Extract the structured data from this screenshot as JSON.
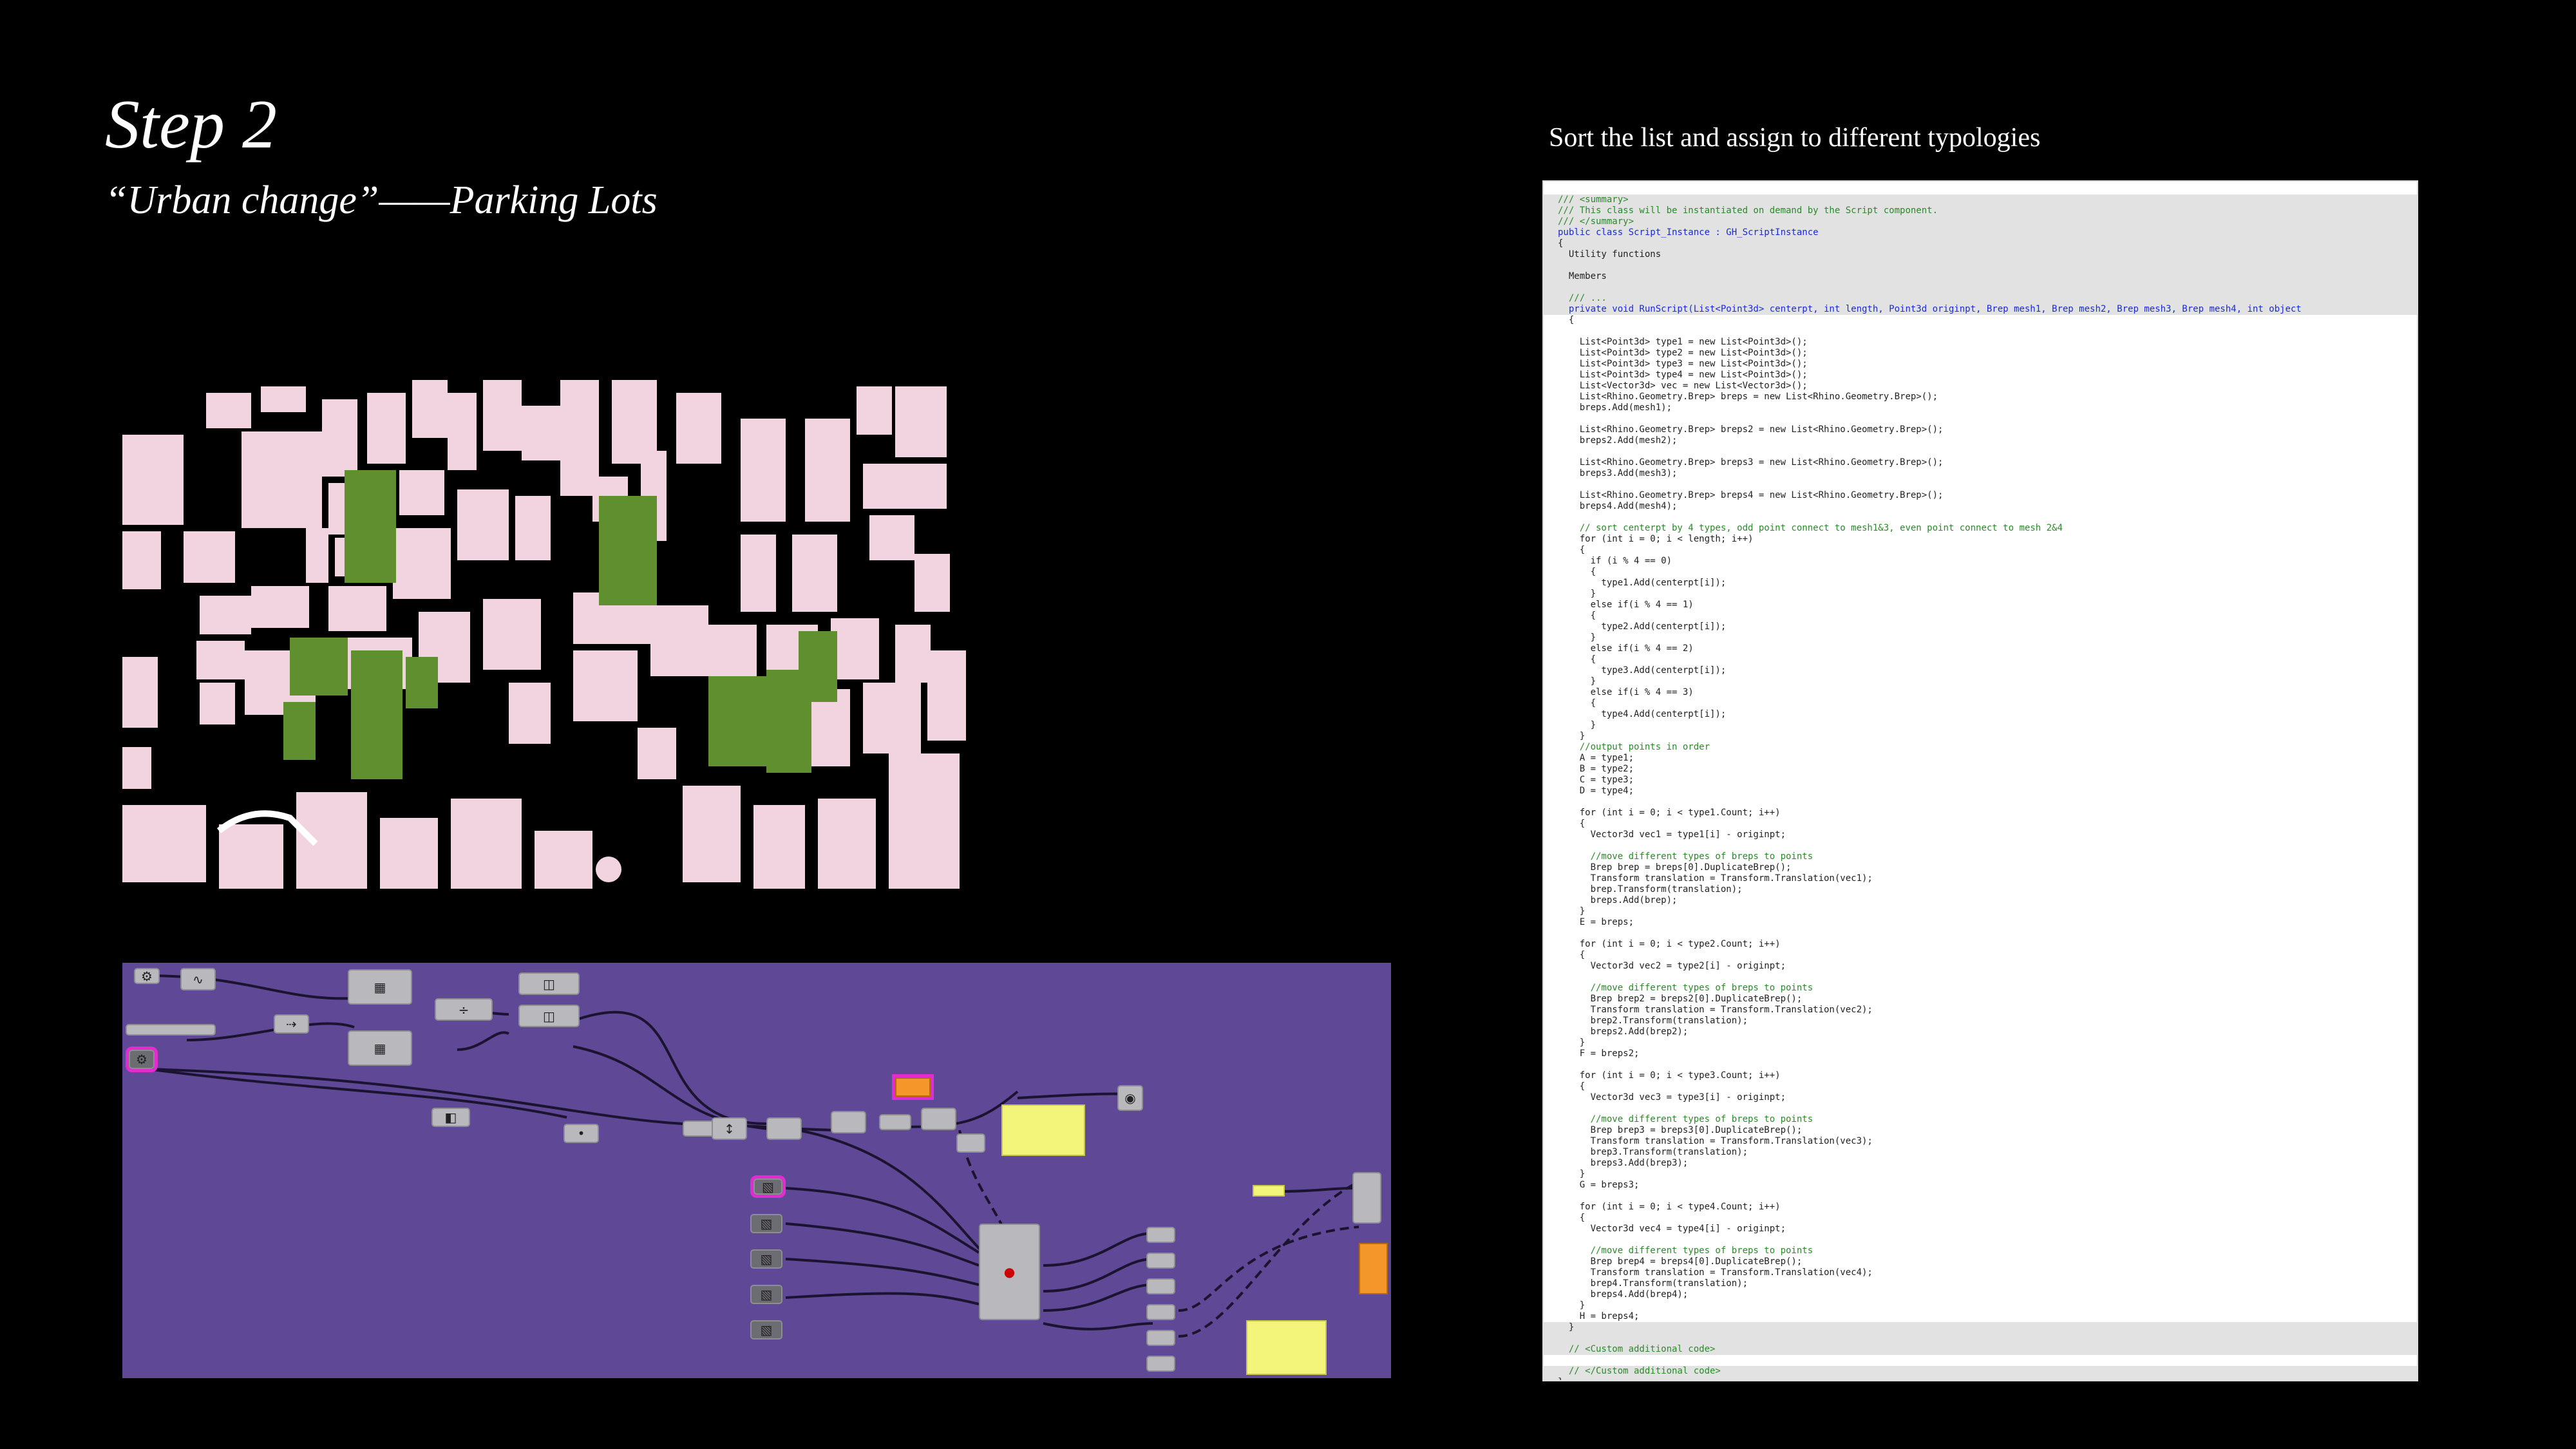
{
  "slide": {
    "title": "Step 2",
    "subtitle": "“Urban change”——Parking Lots",
    "code_caption": "Sort the list and assign to different typologies"
  },
  "colors": {
    "background": "#000000",
    "map_building": "#f2d3e0",
    "map_parking": "#5f8f2f",
    "canvas": "#5f4896",
    "panel": "#f3f57a",
    "component": "#b9b9bd",
    "highlight": "#e12ccf",
    "output_param": "#f5962a",
    "code_comment": "#2a8a2a",
    "code_keyword": "#1a2ad8"
  },
  "code_lines": [
    {
      "text": "/// <summary>",
      "cls": "cm",
      "gray": true
    },
    {
      "text": "/// This class will be instantiated on demand by the Script component.",
      "cls": "cm",
      "gray": true
    },
    {
      "text": "/// </summary>",
      "cls": "cm",
      "gray": true
    },
    {
      "text": "public class Script_Instance : GH_ScriptInstance",
      "cls": "kw",
      "gray": true
    },
    {
      "text": "{",
      "cls": "",
      "gray": true
    },
    {
      "text": "  Utility functions",
      "cls": "",
      "gray": true
    },
    {
      "text": "",
      "cls": "",
      "gray": true
    },
    {
      "text": "  Members",
      "cls": "",
      "gray": true
    },
    {
      "text": "",
      "cls": "",
      "gray": true
    },
    {
      "text": "  /// ...",
      "cls": "cm",
      "gray": true
    },
    {
      "text": "  private void RunScript(List<Point3d> centerpt, int length, Point3d originpt, Brep mesh1, Brep mesh2, Brep mesh3, Brep mesh4, int object",
      "cls": "kw",
      "gray": true
    },
    {
      "text": "  {",
      "cls": "",
      "gray": false
    },
    {
      "text": "",
      "cls": "",
      "gray": false
    },
    {
      "text": "    List<Point3d> type1 = new List<Point3d>();",
      "cls": "",
      "gray": false
    },
    {
      "text": "    List<Point3d> type2 = new List<Point3d>();",
      "cls": "",
      "gray": false
    },
    {
      "text": "    List<Point3d> type3 = new List<Point3d>();",
      "cls": "",
      "gray": false
    },
    {
      "text": "    List<Point3d> type4 = new List<Point3d>();",
      "cls": "",
      "gray": false
    },
    {
      "text": "    List<Vector3d> vec = new List<Vector3d>();",
      "cls": "",
      "gray": false
    },
    {
      "text": "    List<Rhino.Geometry.Brep> breps = new List<Rhino.Geometry.Brep>();",
      "cls": "",
      "gray": false
    },
    {
      "text": "    breps.Add(mesh1);",
      "cls": "",
      "gray": false
    },
    {
      "text": "",
      "cls": "",
      "gray": false
    },
    {
      "text": "    List<Rhino.Geometry.Brep> breps2 = new List<Rhino.Geometry.Brep>();",
      "cls": "",
      "gray": false
    },
    {
      "text": "    breps2.Add(mesh2);",
      "cls": "",
      "gray": false
    },
    {
      "text": "",
      "cls": "",
      "gray": false
    },
    {
      "text": "    List<Rhino.Geometry.Brep> breps3 = new List<Rhino.Geometry.Brep>();",
      "cls": "",
      "gray": false
    },
    {
      "text": "    breps3.Add(mesh3);",
      "cls": "",
      "gray": false
    },
    {
      "text": "",
      "cls": "",
      "gray": false
    },
    {
      "text": "    List<Rhino.Geometry.Brep> breps4 = new List<Rhino.Geometry.Brep>();",
      "cls": "",
      "gray": false
    },
    {
      "text": "    breps4.Add(mesh4);",
      "cls": "",
      "gray": false
    },
    {
      "text": "",
      "cls": "",
      "gray": false
    },
    {
      "text": "    // sort centerpt by 4 types, odd point connect to mesh1&3, even point connect to mesh 2&4",
      "cls": "cm",
      "gray": false
    },
    {
      "text": "    for (int i = 0; i < length; i++)",
      "cls": "",
      "gray": false
    },
    {
      "text": "    {",
      "cls": "",
      "gray": false
    },
    {
      "text": "      if (i % 4 == 0)",
      "cls": "",
      "gray": false
    },
    {
      "text": "      {",
      "cls": "",
      "gray": false
    },
    {
      "text": "        type1.Add(centerpt[i]);",
      "cls": "",
      "gray": false
    },
    {
      "text": "      }",
      "cls": "",
      "gray": false
    },
    {
      "text": "      else if(i % 4 == 1)",
      "cls": "",
      "gray": false
    },
    {
      "text": "      {",
      "cls": "",
      "gray": false
    },
    {
      "text": "        type2.Add(centerpt[i]);",
      "cls": "",
      "gray": false
    },
    {
      "text": "      }",
      "cls": "",
      "gray": false
    },
    {
      "text": "      else if(i % 4 == 2)",
      "cls": "",
      "gray": false
    },
    {
      "text": "      {",
      "cls": "",
      "gray": false
    },
    {
      "text": "        type3.Add(centerpt[i]);",
      "cls": "",
      "gray": false
    },
    {
      "text": "      }",
      "cls": "",
      "gray": false
    },
    {
      "text": "      else if(i % 4 == 3)",
      "cls": "",
      "gray": false
    },
    {
      "text": "      {",
      "cls": "",
      "gray": false
    },
    {
      "text": "        type4.Add(centerpt[i]);",
      "cls": "",
      "gray": false
    },
    {
      "text": "      }",
      "cls": "",
      "gray": false
    },
    {
      "text": "    }",
      "cls": "",
      "gray": false
    },
    {
      "text": "    //output points in order",
      "cls": "cm",
      "gray": false
    },
    {
      "text": "    A = type1;",
      "cls": "",
      "gray": false
    },
    {
      "text": "    B = type2;",
      "cls": "",
      "gray": false
    },
    {
      "text": "    C = type3;",
      "cls": "",
      "gray": false
    },
    {
      "text": "    D = type4;",
      "cls": "",
      "gray": false
    },
    {
      "text": "",
      "cls": "",
      "gray": false
    },
    {
      "text": "    for (int i = 0; i < type1.Count; i++)",
      "cls": "",
      "gray": false
    },
    {
      "text": "    {",
      "cls": "",
      "gray": false
    },
    {
      "text": "      Vector3d vec1 = type1[i] - originpt;",
      "cls": "",
      "gray": false
    },
    {
      "text": "",
      "cls": "",
      "gray": false
    },
    {
      "text": "      //move different types of breps to points",
      "cls": "cm",
      "gray": false
    },
    {
      "text": "      Brep brep = breps[0].DuplicateBrep();",
      "cls": "",
      "gray": false
    },
    {
      "text": "      Transform translation = Transform.Translation(vec1);",
      "cls": "",
      "gray": false
    },
    {
      "text": "      brep.Transform(translation);",
      "cls": "",
      "gray": false
    },
    {
      "text": "      breps.Add(brep);",
      "cls": "",
      "gray": false
    },
    {
      "text": "    }",
      "cls": "",
      "gray": false
    },
    {
      "text": "    E = breps;",
      "cls": "",
      "gray": false
    },
    {
      "text": "",
      "cls": "",
      "gray": false
    },
    {
      "text": "    for (int i = 0; i < type2.Count; i++)",
      "cls": "",
      "gray": false
    },
    {
      "text": "    {",
      "cls": "",
      "gray": false
    },
    {
      "text": "      Vector3d vec2 = type2[i] - originpt;",
      "cls": "",
      "gray": false
    },
    {
      "text": "",
      "cls": "",
      "gray": false
    },
    {
      "text": "      //move different types of breps to points",
      "cls": "cm",
      "gray": false
    },
    {
      "text": "      Brep brep2 = breps2[0].DuplicateBrep();",
      "cls": "",
      "gray": false
    },
    {
      "text": "      Transform translation = Transform.Translation(vec2);",
      "cls": "",
      "gray": false
    },
    {
      "text": "      brep2.Transform(translation);",
      "cls": "",
      "gray": false
    },
    {
      "text": "      breps2.Add(brep2);",
      "cls": "",
      "gray": false
    },
    {
      "text": "    }",
      "cls": "",
      "gray": false
    },
    {
      "text": "    F = breps2;",
      "cls": "",
      "gray": false
    },
    {
      "text": "",
      "cls": "",
      "gray": false
    },
    {
      "text": "    for (int i = 0; i < type3.Count; i++)",
      "cls": "",
      "gray": false
    },
    {
      "text": "    {",
      "cls": "",
      "gray": false
    },
    {
      "text": "      Vector3d vec3 = type3[i] - originpt;",
      "cls": "",
      "gray": false
    },
    {
      "text": "",
      "cls": "",
      "gray": false
    },
    {
      "text": "      //move different types of breps to points",
      "cls": "cm",
      "gray": false
    },
    {
      "text": "      Brep brep3 = breps3[0].DuplicateBrep();",
      "cls": "",
      "gray": false
    },
    {
      "text": "      Transform translation = Transform.Translation(vec3);",
      "cls": "",
      "gray": false
    },
    {
      "text": "      brep3.Transform(translation);",
      "cls": "",
      "gray": false
    },
    {
      "text": "      breps3.Add(brep3);",
      "cls": "",
      "gray": false
    },
    {
      "text": "    }",
      "cls": "",
      "gray": false
    },
    {
      "text": "    G = breps3;",
      "cls": "",
      "gray": false
    },
    {
      "text": "",
      "cls": "",
      "gray": false
    },
    {
      "text": "    for (int i = 0; i < type4.Count; i++)",
      "cls": "",
      "gray": false
    },
    {
      "text": "    {",
      "cls": "",
      "gray": false
    },
    {
      "text": "      Vector3d vec4 = type4[i] - originpt;",
      "cls": "",
      "gray": false
    },
    {
      "text": "",
      "cls": "",
      "gray": false
    },
    {
      "text": "      //move different types of breps to points",
      "cls": "cm",
      "gray": false
    },
    {
      "text": "      Brep brep4 = breps4[0].DuplicateBrep();",
      "cls": "",
      "gray": false
    },
    {
      "text": "      Transform translation = Transform.Translation(vec4);",
      "cls": "",
      "gray": false
    },
    {
      "text": "      brep4.Transform(translation);",
      "cls": "",
      "gray": false
    },
    {
      "text": "      breps4.Add(brep4);",
      "cls": "",
      "gray": false
    },
    {
      "text": "    }",
      "cls": "",
      "gray": false
    },
    {
      "text": "    H = breps4;",
      "cls": "",
      "gray": false
    },
    {
      "text": "  }",
      "cls": "",
      "gray": true
    },
    {
      "text": "",
      "cls": "",
      "gray": true
    },
    {
      "text": "  // <Custom additional code>",
      "cls": "cm",
      "gray": true
    },
    {
      "text": "",
      "cls": "",
      "gray": false
    },
    {
      "text": "  // </Custom additional code>",
      "cls": "cm",
      "gray": true
    },
    {
      "text": "}",
      "cls": "",
      "gray": true
    }
  ]
}
